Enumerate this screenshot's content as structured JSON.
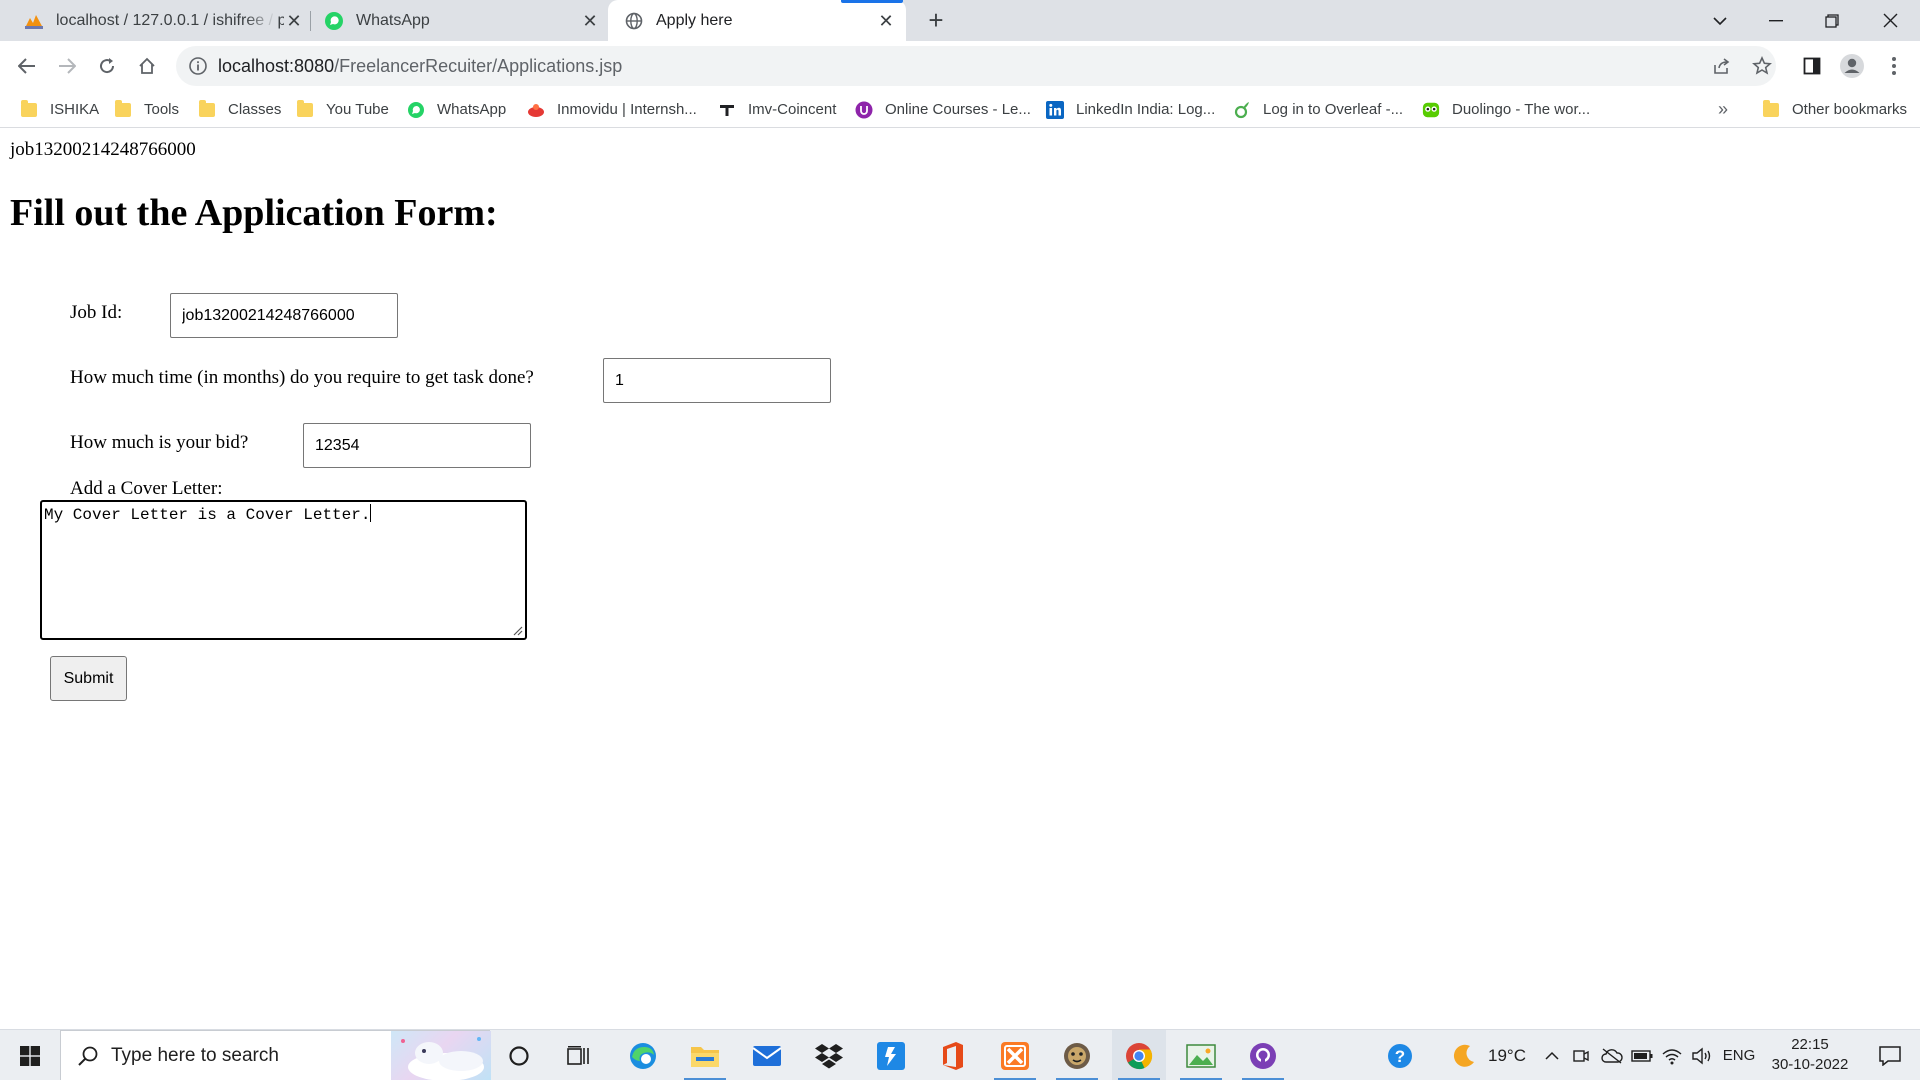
{
  "browser": {
    "tabs": [
      {
        "title": "localhost / 127.0.0.1 / ishifree / p",
        "icon": "phpmyadmin-icon"
      },
      {
        "title": "WhatsApp",
        "icon": "whatsapp-icon"
      },
      {
        "title": "Apply here",
        "icon": "globe-icon"
      }
    ],
    "new_tab": "+",
    "url_host": "localhost:8080",
    "url_path": "/FreelancerRecuiter/Applications.jsp",
    "bookmarks": [
      {
        "label": "ISHIKA",
        "icon": "folder-icon"
      },
      {
        "label": "Tools",
        "icon": "folder-icon"
      },
      {
        "label": "Classes",
        "icon": "folder-icon"
      },
      {
        "label": "You Tube",
        "icon": "folder-icon"
      },
      {
        "label": "WhatsApp",
        "icon": "whatsapp-icon"
      },
      {
        "label": "Inmovidu | Internsh...",
        "icon": "inmovidu-icon"
      },
      {
        "label": "Imv-Coincent",
        "icon": "imv-icon"
      },
      {
        "label": "Online Courses - Le...",
        "icon": "courses-icon"
      },
      {
        "label": "LinkedIn India: Log...",
        "icon": "linkedin-icon"
      },
      {
        "label": "Log in to Overleaf -...",
        "icon": "overleaf-icon"
      },
      {
        "label": "Duolingo - The wor...",
        "icon": "duolingo-icon"
      }
    ],
    "bookmarks_overflow": "»",
    "other_bookmarks": "Other bookmarks"
  },
  "page": {
    "job_header": "job13200214248766000",
    "title": "Fill out the Application Form:",
    "form": {
      "job_id_label": "Job Id:",
      "job_id_value": "job13200214248766000",
      "time_label": "How much time (in months) do you require to get task done?",
      "time_value": "1",
      "bid_label": "How much is your bid?",
      "bid_value": "12354",
      "cover_label": "Add a Cover Letter:",
      "cover_value": "My Cover Letter is a Cover Letter.",
      "submit_label": "Submit"
    }
  },
  "taskbar": {
    "search_placeholder": "Type here to search",
    "weather": "19°C",
    "language": "ENG",
    "time": "22:15",
    "date": "30-10-2022"
  },
  "colors": {
    "tabstrip": "#dee1e6",
    "accent": "#1a73e8",
    "taskbar": "#ebeef2"
  }
}
